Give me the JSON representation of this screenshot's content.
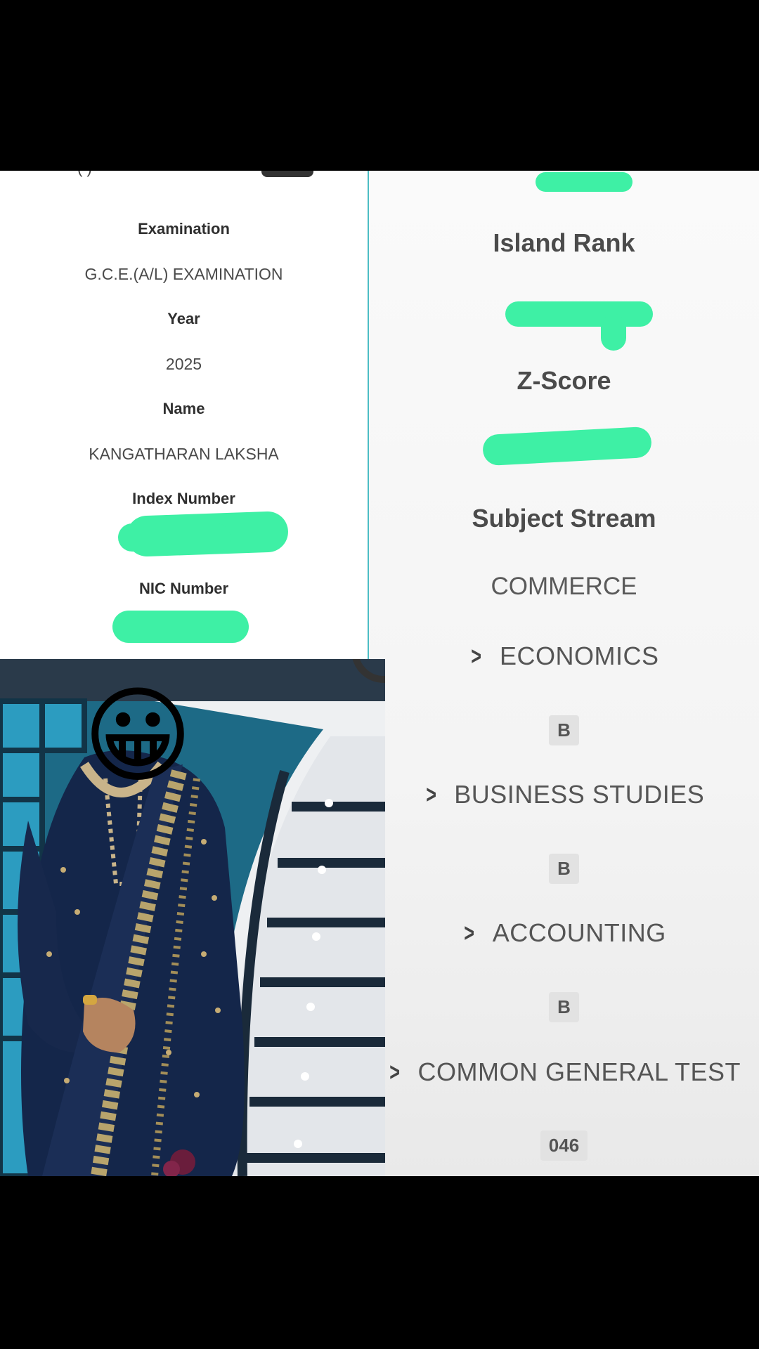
{
  "left_card": {
    "top_partial": "( )",
    "fields": [
      {
        "label": "Examination",
        "value": "G.C.E.(A/L) EXAMINATION"
      },
      {
        "label": "Year",
        "value": "2025"
      },
      {
        "label": "Name",
        "value": "KANGATHARAN LAKSHA"
      },
      {
        "label": "Index Number",
        "value": ""
      },
      {
        "label": "NIC Number",
        "value": ""
      }
    ]
  },
  "right_panel": {
    "island_rank_label": "Island Rank",
    "z_score_label": "Z-Score",
    "subject_stream_label": "Subject Stream",
    "subject_stream_value": "COMMERCE",
    "subjects": [
      {
        "name": "ECONOMICS",
        "grade": "B"
      },
      {
        "name": "BUSINESS STUDIES",
        "grade": "B"
      },
      {
        "name": "ACCOUNTING",
        "grade": "B"
      },
      {
        "name": "COMMON GENERAL TEST",
        "grade": "046"
      }
    ]
  },
  "photo": {
    "face_cover_emoji": "😀"
  },
  "colors": {
    "redaction": "#3ef0a5",
    "divider": "#4cbdc4",
    "dress": "#14264a"
  }
}
